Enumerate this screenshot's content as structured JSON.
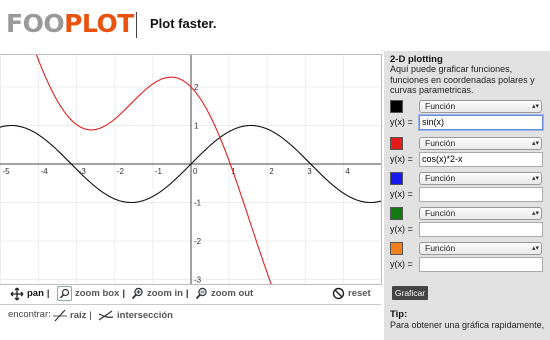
{
  "header": {
    "logo_part1": "FOO",
    "logo_part2": "PLOT",
    "tagline": "Plot faster."
  },
  "plot": {
    "x_ticks": [
      "-5",
      "-4",
      "-3",
      "-2",
      "-1",
      "0",
      "1",
      "2",
      "3",
      "4"
    ],
    "y_ticks": [
      "3",
      "2",
      "1",
      "0",
      "-1",
      "-2",
      "-3"
    ],
    "curve_colors": [
      "#111111",
      "#e02020"
    ]
  },
  "toolbar": {
    "pan": "pan",
    "zoom_box": "zoom box",
    "zoom_in": "zoom in",
    "zoom_out": "zoom out",
    "reset": "reset",
    "separator": "|"
  },
  "find": {
    "label": "encontrar:",
    "root": "raíz",
    "intersection": "intersección",
    "separator": "|"
  },
  "panel": {
    "title": "2-D plotting",
    "description": "Aquí puede graficar funciones, funciones en coordenadas polares y curvas parametricas.",
    "functions": [
      {
        "color": "#000000",
        "type": "Función",
        "label": "y(x) =",
        "value": "sin(x)"
      },
      {
        "color": "#e41b1b",
        "type": "Función",
        "label": "y(x) =",
        "value": "cos(x)*2-x"
      },
      {
        "color": "#1a1aee",
        "type": "Función",
        "label": "y(x) =",
        "value": ""
      },
      {
        "color": "#137a13",
        "type": "Función",
        "label": "y(x) =",
        "value": ""
      },
      {
        "color": "#f0801c",
        "type": "Función",
        "label": "y(x) =",
        "value": ""
      }
    ],
    "button": "Graficar",
    "tip_title": "Tip:",
    "tip_text": "Para obtener una gráfica rapidamente,"
  }
}
